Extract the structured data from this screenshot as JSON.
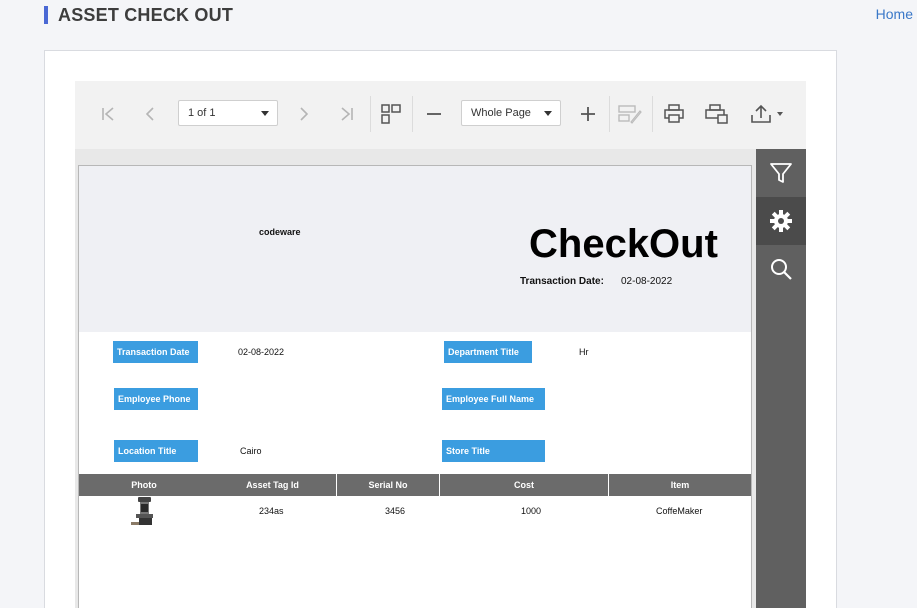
{
  "page": {
    "title": "ASSET CHECK OUT",
    "home_link": "Home"
  },
  "toolbar": {
    "page_select": "1 of 1",
    "zoom_select": "Whole Page",
    "icons": [
      "first-page",
      "previous-page",
      "next-page",
      "last-page",
      "multipage",
      "zoom-out",
      "zoom-in",
      "editing-fields",
      "print",
      "print-page",
      "export"
    ]
  },
  "report": {
    "company": "codeware",
    "title": "CheckOut",
    "transaction_date_label": "Transaction Date:",
    "transaction_date_value": "02-08-2022",
    "fields": {
      "transaction_date": {
        "label": "Transaction Date",
        "value": "02-08-2022"
      },
      "department_title": {
        "label": "Department Title",
        "value": "Hr"
      },
      "employee_phone": {
        "label": "Employee Phone",
        "value": ""
      },
      "employee_full_name": {
        "label": "Employee Full Name",
        "value": ""
      },
      "location_title": {
        "label": "Location Title",
        "value": "Cairo"
      },
      "store_title": {
        "label": "Store Title",
        "value": ""
      }
    },
    "table": {
      "headers": [
        "Photo",
        "Asset Tag Id",
        "Serial No",
        "Cost",
        "Item"
      ],
      "rows": [
        {
          "photo": "coffee-maker-photo",
          "asset_tag_id": "234as",
          "serial_no": "3456",
          "cost": "1000",
          "item": "CoffeMaker"
        }
      ]
    }
  },
  "side_panel": {
    "icons": [
      "filter",
      "settings",
      "search"
    ],
    "active": "settings"
  },
  "colors": {
    "accent": "#4a68d4",
    "label_bg": "#3b9de0",
    "table_header": "#6b6b6b",
    "side_panel": "#606060"
  }
}
